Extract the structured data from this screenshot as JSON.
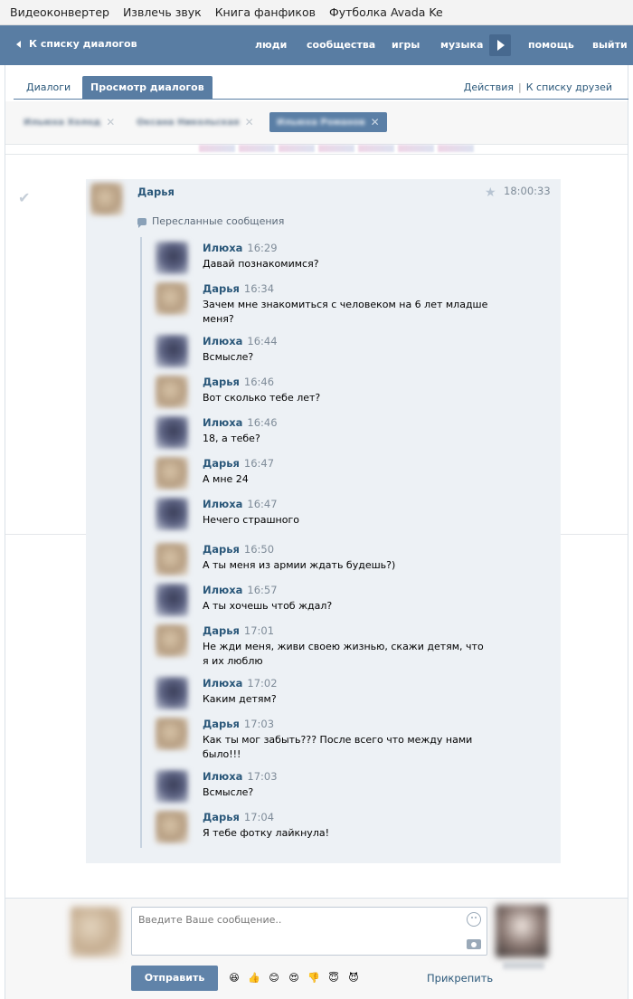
{
  "bookmarks": [
    "Видеоконвертер",
    "Извлечь звук",
    "Книга фанфиков",
    "Футболка Avada Ke"
  ],
  "header": {
    "back_label": "К списку диалогов",
    "nav": [
      "люди",
      "сообщества",
      "игры",
      "музыка",
      "помощь",
      "выйти"
    ]
  },
  "tabs": {
    "inactive": "Диалоги",
    "active": "Просмотр диалогов",
    "actions": "Действия",
    "separator": "|",
    "friends_link": "К списку друзей"
  },
  "chips": [
    {
      "label": "Ильюха Холод",
      "selected": false
    },
    {
      "label": "Оксана Никольская",
      "selected": false
    },
    {
      "label": "Ильюха Романов",
      "selected": true
    }
  ],
  "message": {
    "author": "Дарья",
    "time": "18:00:33",
    "forwarded_label": "Пересланные сообщения",
    "forwarded": [
      {
        "author": "Илюха",
        "time": "16:29",
        "text": "Давай познакомимся?"
      },
      {
        "author": "Дарья",
        "time": "16:34",
        "text": "Зачем мне знакомиться с человеком на 6 лет младше меня?"
      },
      {
        "author": "Илюха",
        "time": "16:44",
        "text": "Всмысле?"
      },
      {
        "author": "Дарья",
        "time": "16:46",
        "text": "Вот сколько тебе лет?"
      },
      {
        "author": "Илюха",
        "time": "16:46",
        "text": "18, а тебе?"
      },
      {
        "author": "Дарья",
        "time": "16:47",
        "text": "А мне 24"
      },
      {
        "author": "Илюха",
        "time": "16:47",
        "text": "Нечего страшного"
      },
      {
        "author": "Дарья",
        "time": "16:50",
        "text": "А ты меня из армии ждать будешь?)"
      },
      {
        "author": "Илюха",
        "time": "16:57",
        "text": "А ты хочешь чтоб ждал?"
      },
      {
        "author": "Дарья",
        "time": "17:01",
        "text": "Не жди меня, живи своею жизнью, скажи детям, что я их люблю"
      },
      {
        "author": "Илюха",
        "time": "17:02",
        "text": "Каким детям?"
      },
      {
        "author": "Дарья",
        "time": "17:03",
        "text": "Как ты мог забыть??? После всего что между нами было!!!"
      },
      {
        "author": "Илюха",
        "time": "17:03",
        "text": "Всмысле?"
      },
      {
        "author": "Дарья",
        "time": "17:04",
        "text": "Я тебе фотку лайкнула!"
      }
    ]
  },
  "composer": {
    "placeholder": "Введите Ваше сообщение..",
    "send_label": "Отправить",
    "attach_label": "Прикрепить",
    "emojis": [
      "😆",
      "👍",
      "😊",
      "😍",
      "👎",
      "😇",
      "😈"
    ]
  }
}
